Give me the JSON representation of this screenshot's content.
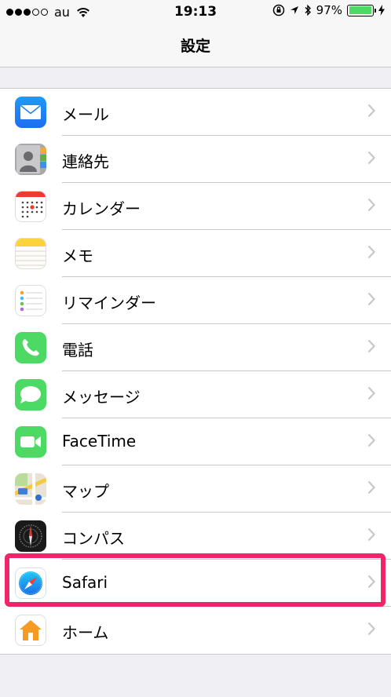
{
  "status_bar": {
    "carrier": "au",
    "time": "19:13",
    "battery_percent": "97%",
    "battery_level": 0.97
  },
  "nav": {
    "title": "設定"
  },
  "settings_items": [
    {
      "label": "メール",
      "icon": "mail-icon"
    },
    {
      "label": "連絡先",
      "icon": "contacts-icon"
    },
    {
      "label": "カレンダー",
      "icon": "calendar-icon"
    },
    {
      "label": "メモ",
      "icon": "notes-icon"
    },
    {
      "label": "リマインダー",
      "icon": "reminders-icon"
    },
    {
      "label": "電話",
      "icon": "phone-icon"
    },
    {
      "label": "メッセージ",
      "icon": "messages-icon"
    },
    {
      "label": "FaceTime",
      "icon": "facetime-icon"
    },
    {
      "label": "マップ",
      "icon": "maps-icon"
    },
    {
      "label": "コンパス",
      "icon": "compass-icon"
    },
    {
      "label": "Safari",
      "icon": "safari-icon",
      "highlighted": true
    },
    {
      "label": "ホーム",
      "icon": "home-icon"
    }
  ],
  "colors": {
    "highlight": "#f0246a",
    "battery": "#4cd964",
    "background": "#efeff4"
  }
}
